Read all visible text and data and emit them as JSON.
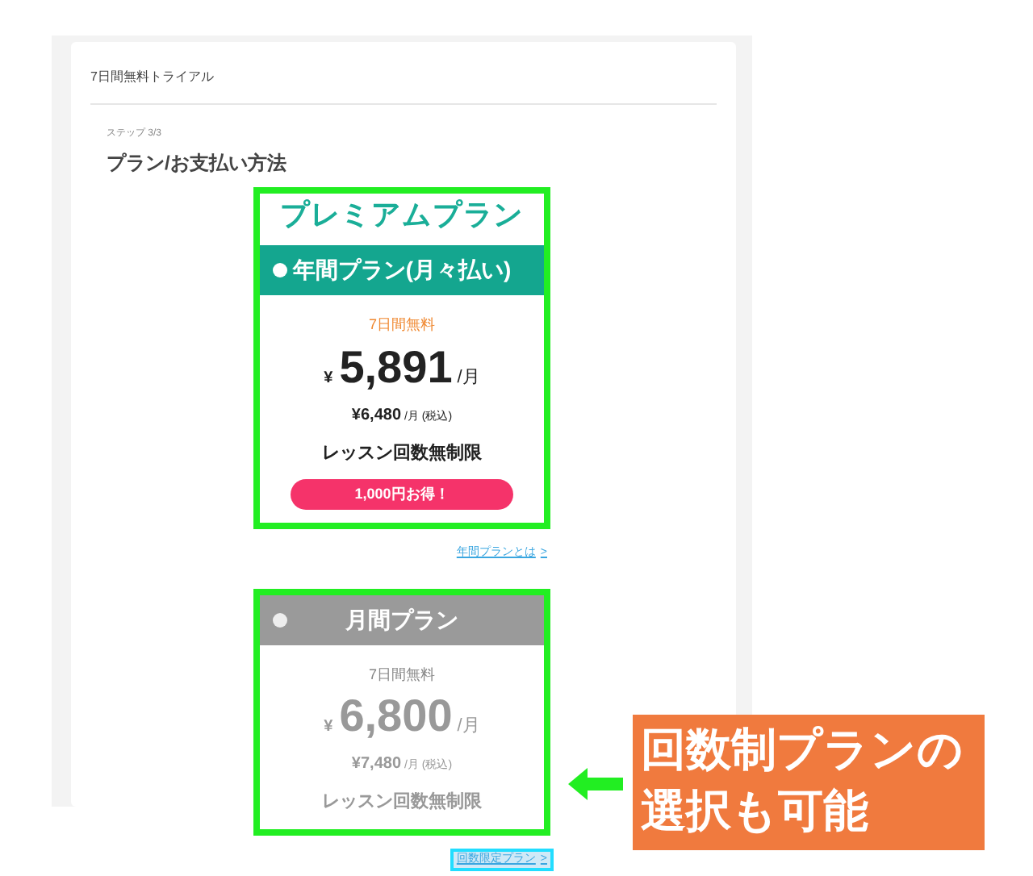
{
  "header": {
    "title": "7日間無料トライアル"
  },
  "step": "ステップ 3/3",
  "heading": "プラン/お支払い方法",
  "plans": [
    {
      "group_title": "プレミアムプラン",
      "name": "年間プラン(月々払い)",
      "selected": true,
      "highlighted": true,
      "trial": "7日間無料",
      "currency": "¥",
      "price": "5,891",
      "unit": "/月",
      "tax_price": "¥6,480",
      "tax_unit": "/月 (税込)",
      "feature": "レッスン回数無制限",
      "badge": "1,000円お得！",
      "link": {
        "text": "年間プランとは",
        "arrow": ">",
        "highlighted": false
      }
    },
    {
      "name": "月間プラン",
      "selected": false,
      "highlighted": true,
      "trial": "7日間無料",
      "currency": "¥",
      "price": "6,800",
      "unit": "/月",
      "tax_price": "¥7,480",
      "tax_unit": "/月 (税込)",
      "feature": "レッスン回数無制限",
      "link": {
        "text": "回数限定プラン",
        "arrow": ">",
        "highlighted": true
      }
    }
  ],
  "callout": {
    "text": "回数制プランの選択も可能"
  }
}
